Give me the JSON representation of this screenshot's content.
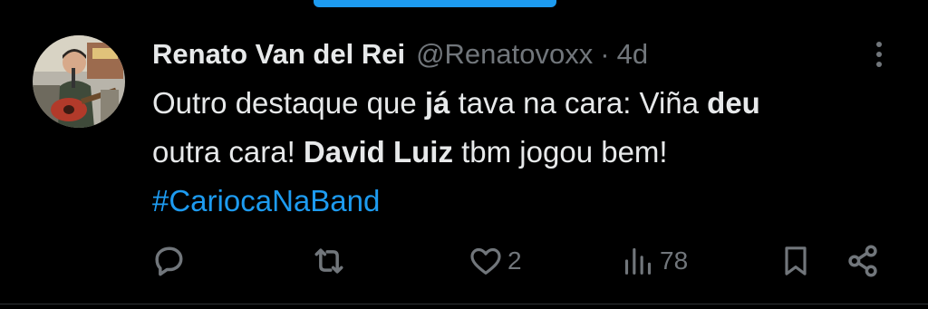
{
  "tweet": {
    "author": {
      "display_name": "Renato Van del Rei",
      "handle": "@Renatovoxx",
      "separator": "·",
      "time": "4d"
    },
    "text": {
      "line1_a": "Outro destaque que ",
      "line1_b": "já",
      "line1_c": " tava na cara: Viña ",
      "line1_d": "deu",
      "line2_a": "outra cara! ",
      "line2_b": "David Luiz",
      "line2_c": " tbm jogou bem!",
      "hashtag": "#CariocaNaBand"
    },
    "actions": {
      "reply": {
        "icon": "reply-icon"
      },
      "retweet": {
        "icon": "retweet-icon"
      },
      "like": {
        "icon": "heart-icon",
        "count": "2"
      },
      "views": {
        "icon": "views-icon",
        "count": "78"
      },
      "bookmark": {
        "icon": "bookmark-icon"
      },
      "share": {
        "icon": "share-icon"
      }
    }
  },
  "colors": {
    "background": "#000000",
    "text": "#e7e9ea",
    "secondary": "#71767b",
    "accent": "#1d9bf0"
  }
}
